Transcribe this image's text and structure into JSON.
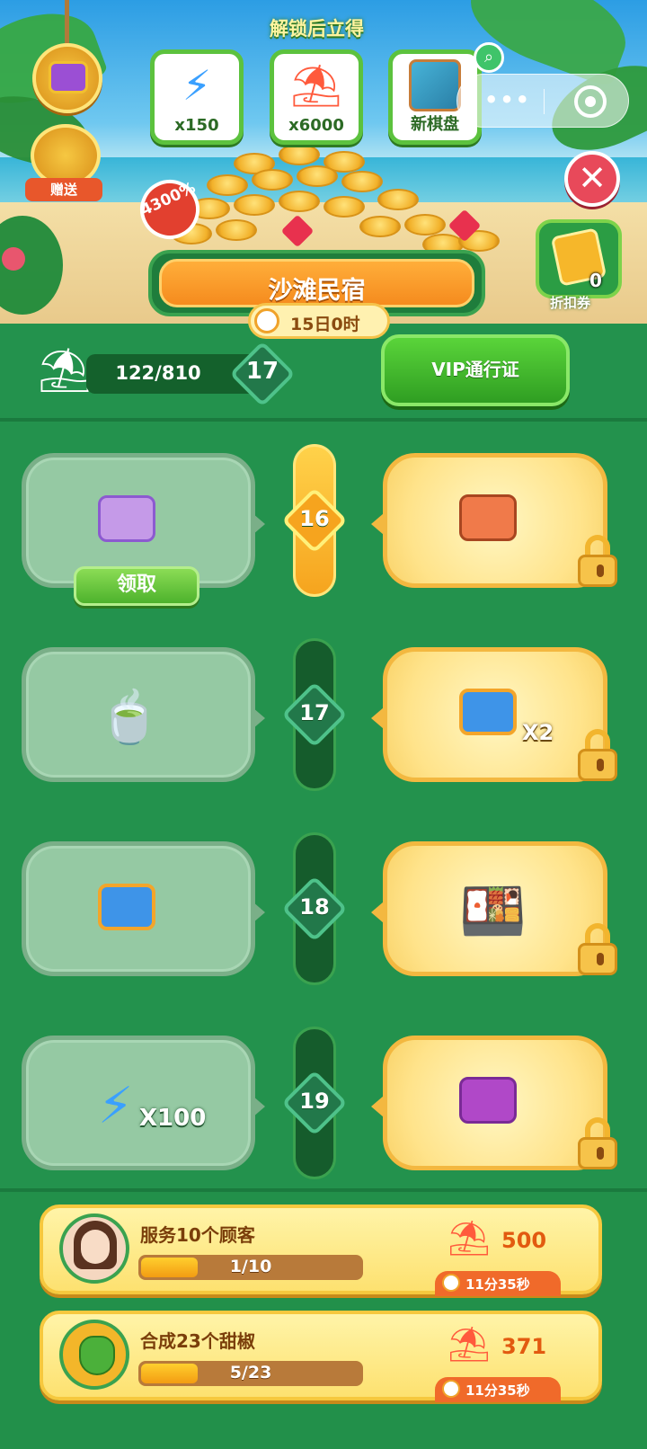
{
  "banner": {
    "unlock_title": "解锁后立得",
    "rewards": [
      {
        "icon": "lightning-icon",
        "label": "x150"
      },
      {
        "icon": "umbrella-coin-icon",
        "label": "x6000"
      },
      {
        "icon": "board-thumbnail",
        "label": "新棋盘"
      }
    ],
    "gift_label": "赠送",
    "percent_badge": "4300%",
    "coupon_label": "折扣券",
    "coupon_count": "0"
  },
  "event": {
    "title": "沙滩民宿",
    "timer": "15日0时",
    "progress_text": "122/810",
    "progress": {
      "current": 122,
      "total": 810
    },
    "level": "17",
    "vip_button": "VIP通行证"
  },
  "rows": [
    {
      "level": "16",
      "free_icon": "purple-chest-icon",
      "free_qty": "",
      "claim_label": "领取",
      "vip_icon": "orange-chest-icon",
      "vip_qty": "",
      "active": true
    },
    {
      "level": "17",
      "free_icon": "tea-cup-icon",
      "free_qty": "",
      "vip_icon": "blue-chest-icon",
      "vip_qty": "X2",
      "active": false
    },
    {
      "level": "18",
      "free_icon": "blue-chest-icon",
      "free_qty": "",
      "vip_icon": "food-platter-icon",
      "vip_qty": "",
      "active": false
    },
    {
      "level": "19",
      "free_icon": "lightning-icon",
      "free_qty": "X100",
      "vip_icon": "violet-chest-icon",
      "vip_qty": "",
      "active": false
    }
  ],
  "tasks": [
    {
      "title": "服务10个顾客",
      "progress_text": "1/10",
      "progress": {
        "current": 1,
        "total": 10
      },
      "reward": "500",
      "timer": "11分35秒"
    },
    {
      "title": "合成23个甜椒",
      "progress_text": "5/23",
      "progress": {
        "current": 5,
        "total": 23
      },
      "reward": "371",
      "timer": "11分35秒"
    }
  ]
}
